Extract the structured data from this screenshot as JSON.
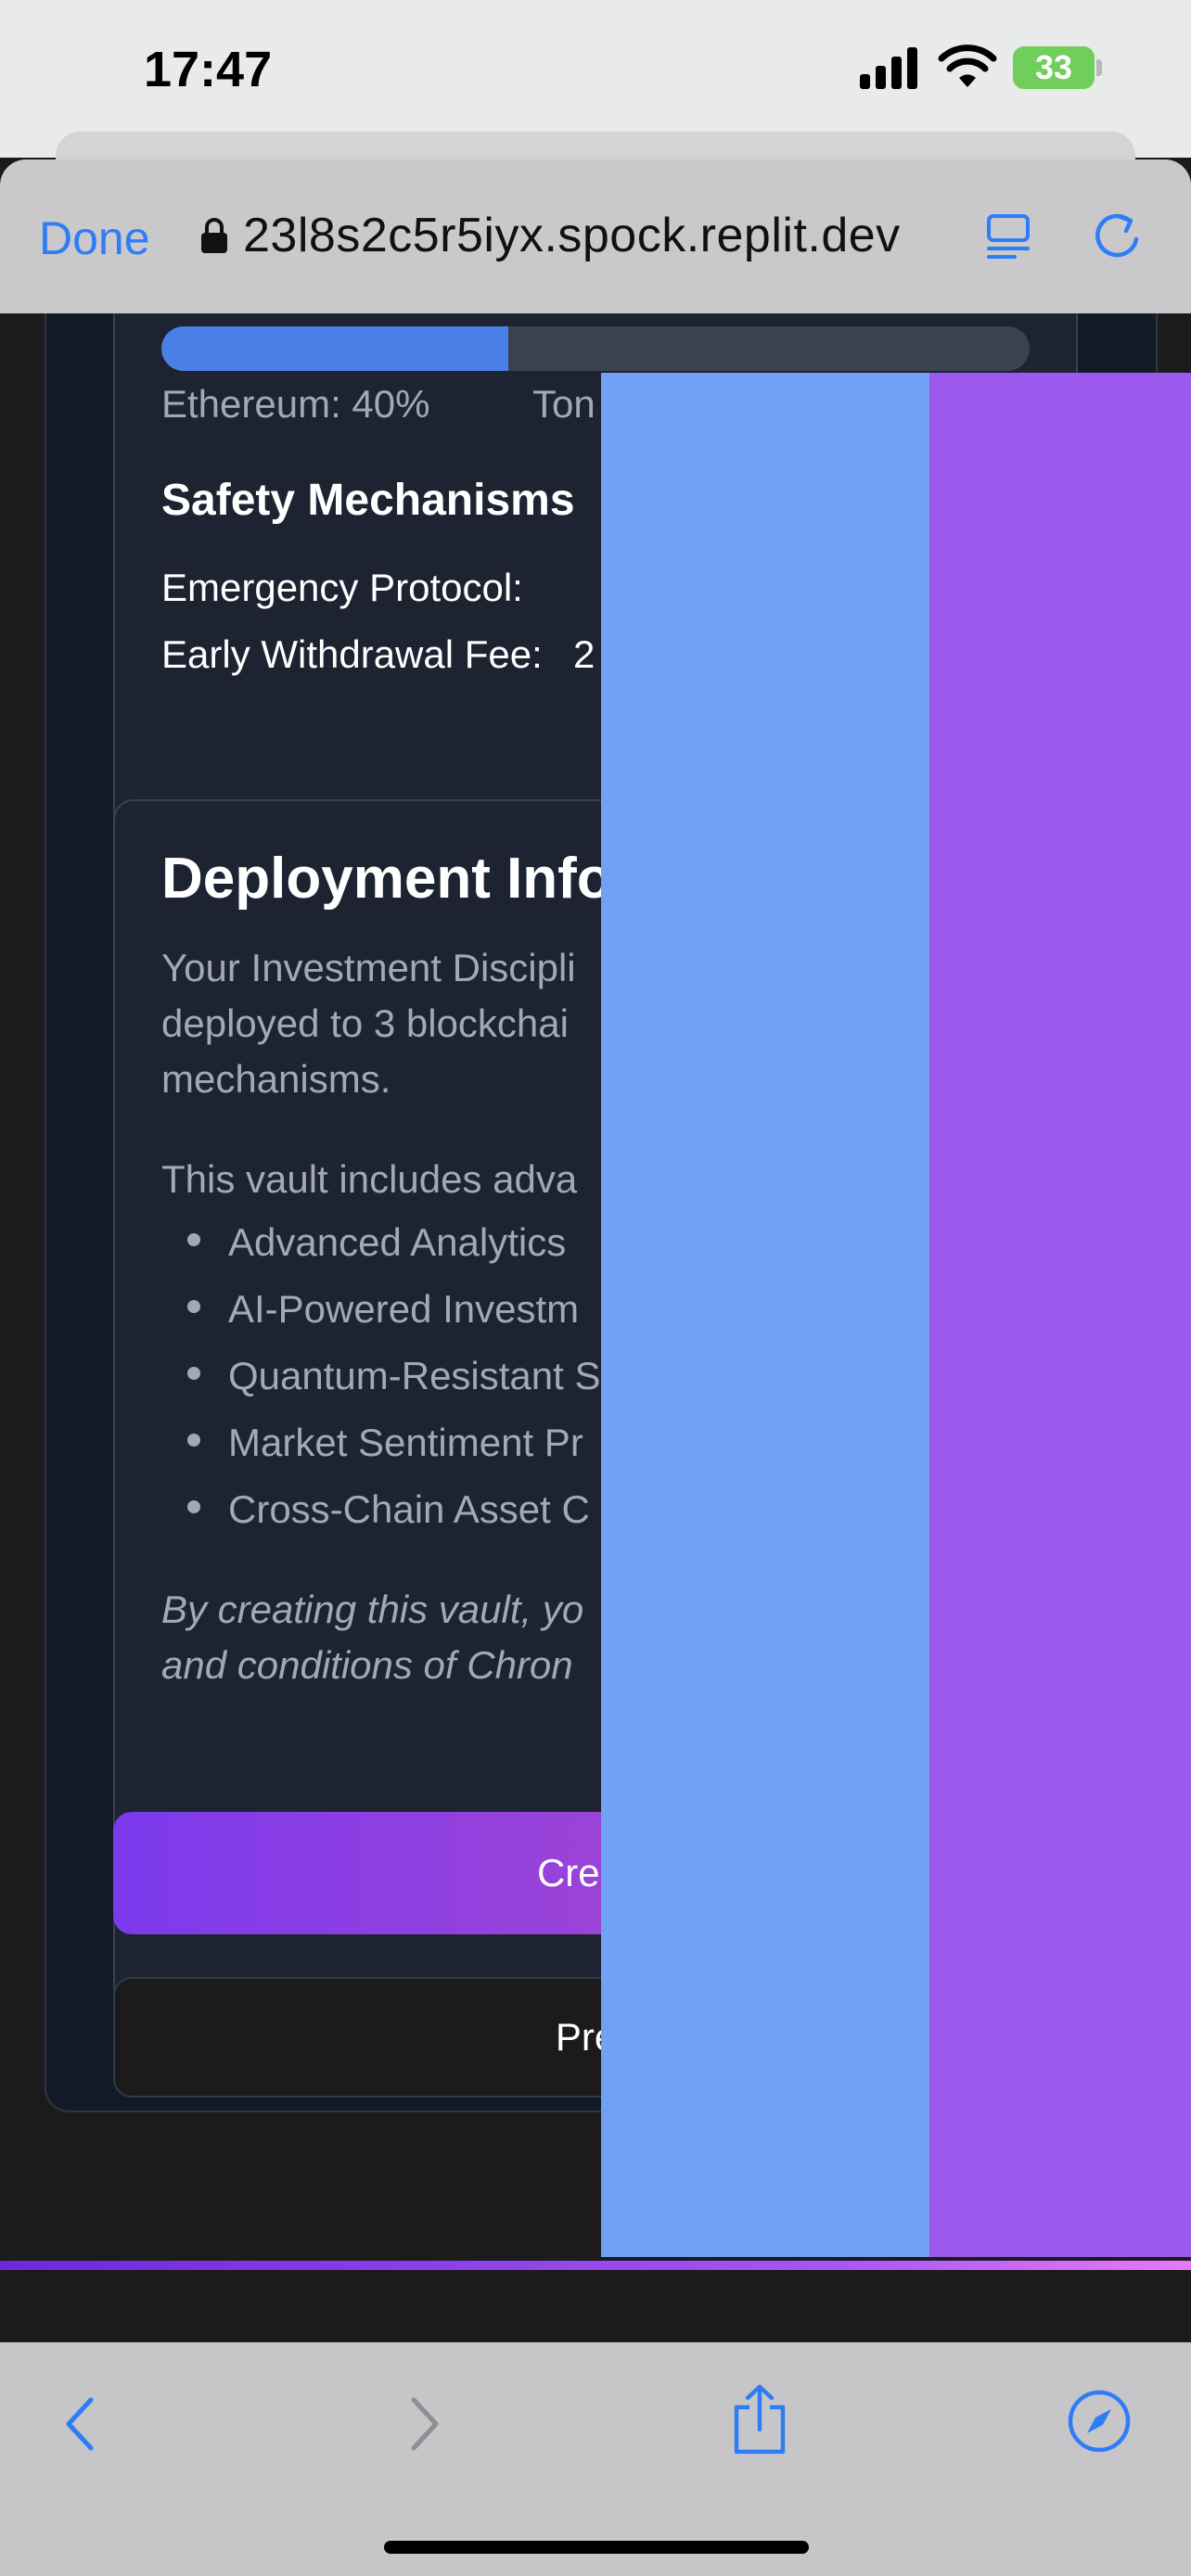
{
  "status_bar": {
    "time": "17:47",
    "battery": "33",
    "icons": [
      "signal-icon",
      "wifi-icon",
      "battery-icon"
    ]
  },
  "browser": {
    "done_label": "Done",
    "url": "23l8s2c5r5iyx.spock.replit.dev",
    "icons": [
      "lock-icon",
      "reader-icon",
      "reload-icon",
      "back-icon",
      "forward-icon",
      "share-icon",
      "compass-icon"
    ]
  },
  "allocation": {
    "ethereum_fraction": 0.4,
    "ethereum_label": "Ethereum: 40%",
    "ton_label_partial": "Ton"
  },
  "safety": {
    "title": "Safety Mechanisms",
    "emergency_label": "Emergency Protocol:",
    "fee_label": "Early Withdrawal Fee:",
    "fee_value_partial": "2"
  },
  "deployment": {
    "title": "Deployment Info",
    "paragraph_lines": [
      "Your Investment Discipli",
      "deployed to 3 blockchai",
      "mechanisms."
    ],
    "features_intro": "This vault includes adva",
    "features": [
      "Advanced Analytics",
      "AI-Powered Investm",
      "Quantum-Resistant S",
      "Market Sentiment Pr",
      "Cross-Chain Asset C"
    ],
    "terms_lines": [
      "By creating this vault, yo",
      "and conditions of Chron"
    ]
  },
  "buttons": {
    "create_label": "Create",
    "previous_label": "Prev"
  },
  "colors": {
    "accent_blue": "#2f7df6",
    "progress_blue": "#4b7fe8",
    "overlay_blue": "#70a1f4",
    "overlay_purple": "#9b59ee",
    "create_gradient_start": "#7c3aed",
    "create_gradient_end": "#b84cc4"
  }
}
